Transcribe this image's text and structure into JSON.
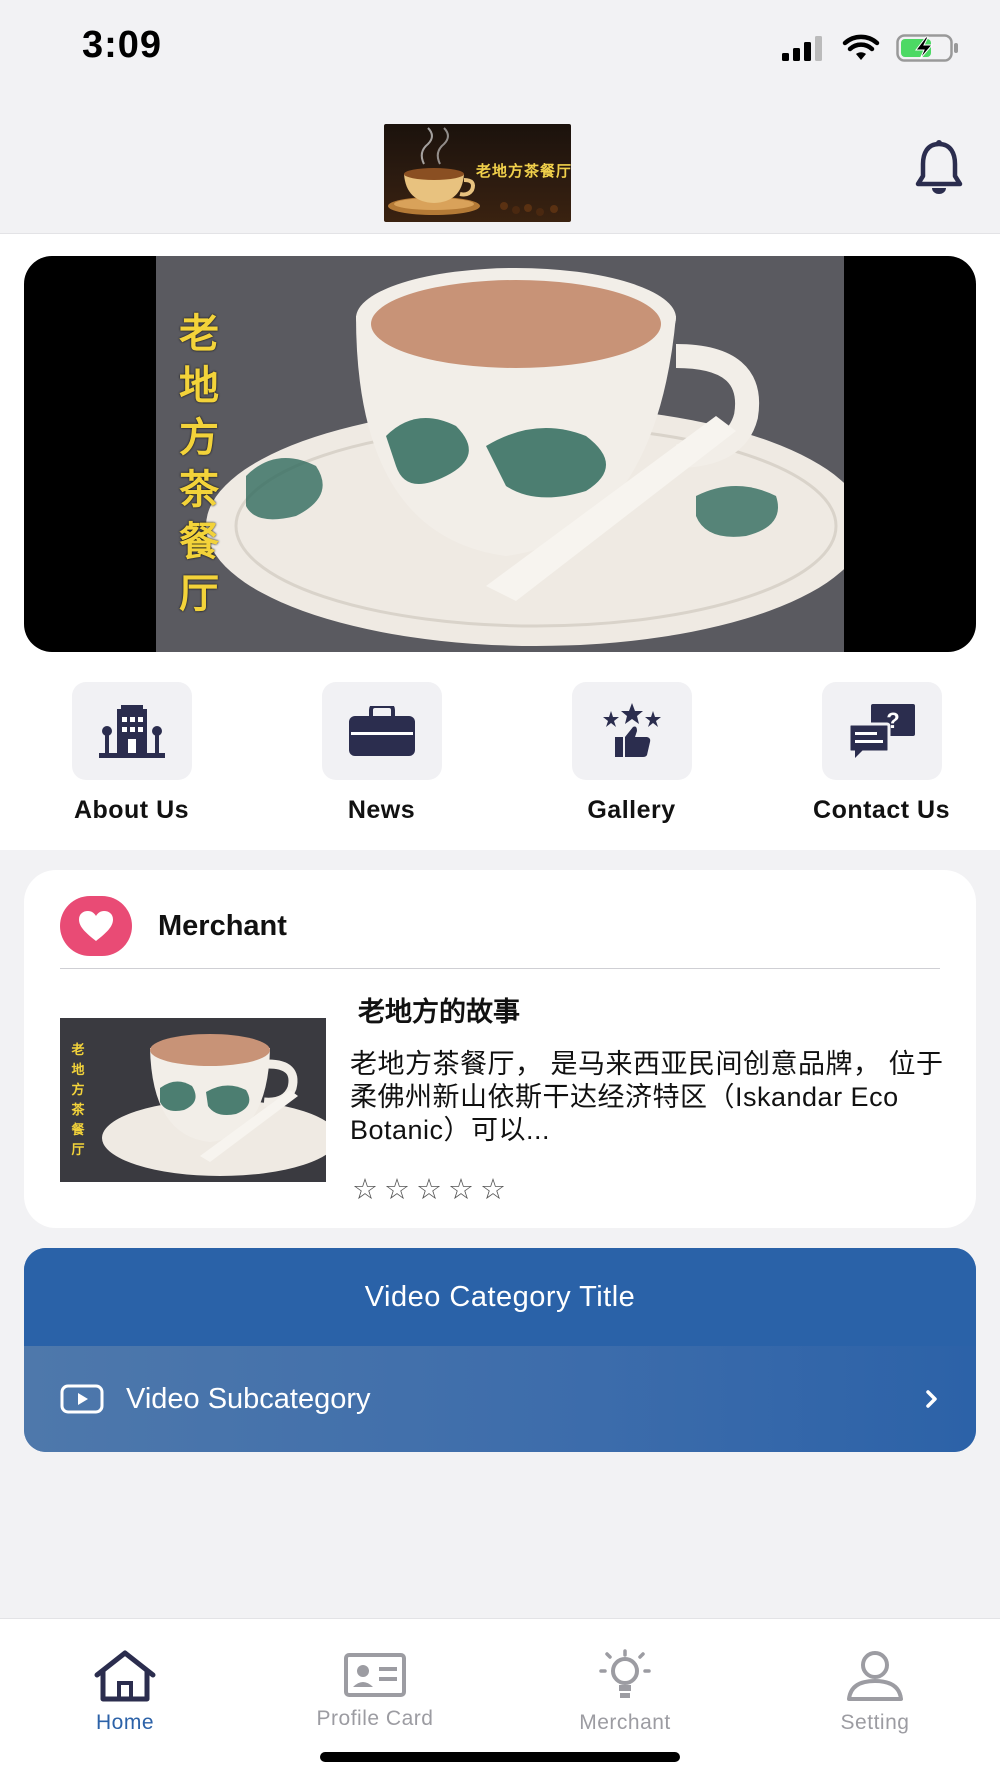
{
  "status": {
    "time": "3:09"
  },
  "header": {
    "logo_text": "老地方茶餐厅"
  },
  "banner": {
    "vertical_text": [
      "老",
      "地",
      "方",
      "茶",
      "餐",
      "厅"
    ]
  },
  "quick_menu": [
    {
      "label": "About Us",
      "icon": "building-icon"
    },
    {
      "label": "News",
      "icon": "briefcase-icon"
    },
    {
      "label": "Gallery",
      "icon": "rating-thumbs-up-icon"
    },
    {
      "label": "Contact Us",
      "icon": "chat-question-icon"
    }
  ],
  "merchant": {
    "section_title": "Merchant",
    "name": "老地方的故事",
    "description": " 老地方茶餐厅， 是马来西亚民间创意品牌， 位于柔佛州新山依斯干达经济特区（Iskandar Eco Botanic）可以...",
    "rating": 0,
    "rating_max": 5,
    "thumb_text": [
      "老",
      "地",
      "方",
      "茶",
      "餐",
      "厅"
    ]
  },
  "video": {
    "category_title": "Video Category Title",
    "subcategory_label": "Video Subcategory"
  },
  "tabs": [
    {
      "label": "Home",
      "icon": "home-icon",
      "active": true
    },
    {
      "label": "Profile Card",
      "icon": "id-card-icon",
      "active": false
    },
    {
      "label": "Merchant",
      "icon": "lightbulb-icon",
      "active": false
    },
    {
      "label": "Setting",
      "icon": "user-icon",
      "active": false
    }
  ],
  "colors": {
    "accent": "#2c62a8",
    "heart": "#e94b75",
    "icon_dark": "#2b2d4e",
    "inactive": "#9c9ca2"
  }
}
